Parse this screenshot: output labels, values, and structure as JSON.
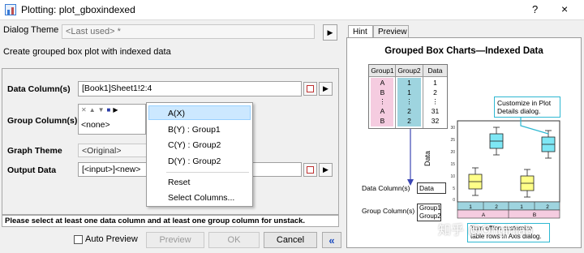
{
  "window": {
    "title": "Plotting: plot_gboxindexed",
    "help": "?",
    "close": "×"
  },
  "dialog_theme": {
    "label": "Dialog Theme",
    "value": "<Last used> *"
  },
  "description": "Create grouped box plot with indexed data",
  "form": {
    "data_columns": {
      "label": "Data Column(s)",
      "value": "[Book1]Sheet1!2:4"
    },
    "group_columns": {
      "label": "Group Column(s)",
      "value": "<none>"
    },
    "graph_theme": {
      "label": "Graph Theme",
      "value": "<Original>"
    },
    "output_data": {
      "label": "Output Data",
      "value": "[<input>]<new>"
    }
  },
  "context_menu": {
    "items": [
      "A(X)",
      "B(Y) : Group1",
      "C(Y) : Group2",
      "D(Y) : Group2",
      "Reset",
      "Select Columns..."
    ]
  },
  "status": "Please select at least one data column and at least one group column for unstack.",
  "buttons": {
    "auto_preview": "Auto Preview",
    "preview": "Preview",
    "ok": "OK",
    "cancel": "Cancel",
    "collapse": "«"
  },
  "tabs": [
    "Hint",
    "Preview"
  ],
  "hint": {
    "title": "Grouped Box Charts—Indexed Data",
    "table": {
      "headers": [
        "Group1",
        "Group2",
        "Data"
      ],
      "rows": [
        [
          "A",
          "1",
          "1"
        ],
        [
          "B",
          "1",
          "2"
        ],
        [
          "⋮",
          "⋮",
          "⋮"
        ],
        [
          "A",
          "2",
          "31"
        ],
        [
          "B",
          "2",
          "32"
        ]
      ]
    },
    "callout_top": "Customize in Plot Details dialog.",
    "callout_bottom": "Turn off/on customize table rows in Axis dialog.",
    "y_axis_label": "Data",
    "y_ticks": [
      "30",
      "25",
      "20",
      "15",
      "10",
      "5",
      "0"
    ],
    "x_row1": [
      "1",
      "2",
      "1",
      "2"
    ],
    "x_row2": [
      "A",
      "B"
    ],
    "data_column_label": "Data Column(s)",
    "data_column_value": "Data",
    "group_column_label": "Group Column(s)",
    "group_column_values": [
      "Group1",
      "Group2"
    ]
  },
  "watermark": "知乎 @Originlab",
  "colors": {
    "yellow_box": "#ffff88",
    "cyan_box": "#7ee7f5",
    "group1_cell": "#f5cce0",
    "group2_cell": "#9ed4df",
    "accent_blue": "#1f4fc1"
  }
}
